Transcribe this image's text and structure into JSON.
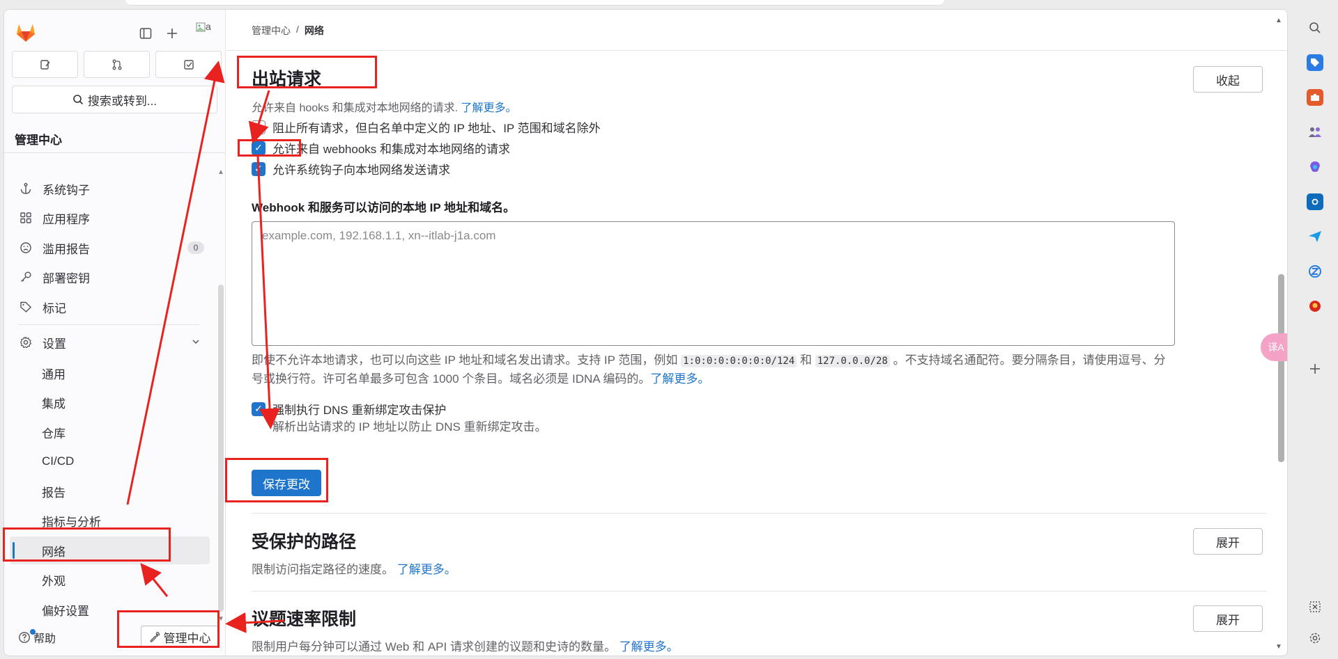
{
  "sidebar": {
    "search_label": "搜索或转到...",
    "section_title": "管理中心",
    "items": [
      {
        "label": "系统钩子",
        "icon": "anchor-icon"
      },
      {
        "label": "应用程序",
        "icon": "grid-icon"
      },
      {
        "label": "滥用报告",
        "icon": "sad-face-icon",
        "badge": "0"
      },
      {
        "label": "部署密钥",
        "icon": "key-icon"
      },
      {
        "label": "标记",
        "icon": "label-icon"
      },
      {
        "label": "设置",
        "icon": "gear-icon"
      }
    ],
    "sub_items": [
      "通用",
      "集成",
      "仓库",
      "CI/CD",
      "报告",
      "指标与分析",
      "网络",
      "外观",
      "偏好设置"
    ],
    "help_label": "帮助",
    "admin_button": "管理中心"
  },
  "breadcrumb": {
    "parent": "管理中心",
    "separator": "/",
    "current": "网络"
  },
  "outbound": {
    "title": "出站请求",
    "description": "允许来自 hooks 和集成对本地网络的请求.",
    "learn_more": "了解更多。",
    "collapse_button": "收起",
    "checkboxes": [
      {
        "label": "阻止所有请求，但白名单中定义的 IP 地址、IP 范围和域名除外",
        "checked": false
      },
      {
        "label": "允许来自 webhooks 和集成对本地网络的请求",
        "checked": true
      },
      {
        "label": "允许系统钩子向本地网络发送请求",
        "checked": true
      }
    ],
    "allowlist_label": "Webhook 和服务可以访问的本地 IP 地址和域名。",
    "allowlist_placeholder": "example.com, 192.168.1.1, xn--itlab-j1a.com",
    "help_part1": "即使不允许本地请求，也可以向这些 IP 地址和域名发出请求。支持 IP 范围，例如 ",
    "help_code1": "1:0:0:0:0:0:0:0/124",
    "help_and": " 和 ",
    "help_code2": "127.0.0.0/28",
    "help_part2": " 。不支持域名通配符。要分隔条目，请使用逗号、分号或换行符。许可名单最多可包含 1000 个条目。域名必须是 IDNA 编码的。",
    "help_link": "了解更多。",
    "dns_label": "强制执行 DNS 重新绑定攻击保护",
    "dns_checked": true,
    "dns_desc": "解析出站请求的 IP 地址以防止 DNS 重新绑定攻击。",
    "save_button": "保存更改"
  },
  "protected_paths": {
    "title": "受保护的路径",
    "description": "限制访问指定路径的速度。",
    "learn_more": "了解更多。",
    "expand_button": "展开"
  },
  "issue_rate": {
    "title": "议题速率限制",
    "description": "限制用户每分钟可以通过 Web 和 API 请求创建的议题和史诗的数量。",
    "learn_more": "了解更多。",
    "expand_button": "展开"
  },
  "avatar_alt": "a",
  "floating_translate": "译A",
  "colors": {
    "accent": "#1f75cb",
    "annotation": "#e8231f"
  }
}
